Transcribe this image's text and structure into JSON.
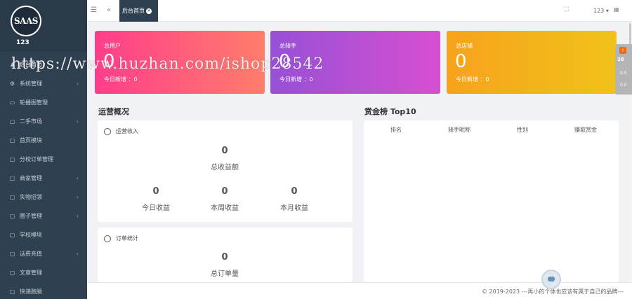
{
  "sidebar": {
    "logo_text": "SAAS",
    "username": "123",
    "items": [
      {
        "label": "后台首页",
        "icon": "user-icon",
        "arrow": false
      },
      {
        "label": "系统管理",
        "icon": "gears-icon",
        "arrow": true
      },
      {
        "label": "轮播图管理",
        "icon": "monitor-icon",
        "arrow": false
      },
      {
        "label": "二手市场",
        "icon": "copy-icon",
        "arrow": true
      },
      {
        "label": "首页模块",
        "icon": "copy-icon",
        "arrow": false
      },
      {
        "label": "分校订单管理",
        "icon": "copy-icon",
        "arrow": false
      },
      {
        "label": "商家管理",
        "icon": "copy-icon",
        "arrow": true
      },
      {
        "label": "失物招领",
        "icon": "copy-icon",
        "arrow": true
      },
      {
        "label": "圈子管理",
        "icon": "copy-icon",
        "arrow": true
      },
      {
        "label": "学校模块",
        "icon": "copy-icon",
        "arrow": false
      },
      {
        "label": "话费充值",
        "icon": "copy-icon",
        "arrow": true
      },
      {
        "label": "文章管理",
        "icon": "copy-icon",
        "arrow": false
      },
      {
        "label": "快递跑腿",
        "icon": "copy-icon",
        "arrow": false
      }
    ]
  },
  "topbar": {
    "tab_label": "后台首页",
    "user": "123 ▾"
  },
  "cards": [
    {
      "label": "总用户",
      "value": "0",
      "sub": "今日新增 ：0",
      "color_from": "#ff3d8b",
      "color_to": "#ff7d6b"
    },
    {
      "label": "总骑手",
      "value": "0",
      "sub": "今日新增 ：0",
      "color_from": "#9650d6",
      "color_to": "#d74fd3"
    },
    {
      "label": "总店铺",
      "value": "0",
      "sub": "今日新增 ：0",
      "color_from": "#f7a21c",
      "color_to": "#f0c21a"
    }
  ],
  "operations": {
    "title": "运营概况",
    "revenue_label": "运营收入",
    "total_value": "0",
    "total_label": "总收益额",
    "stats": [
      {
        "value": "0",
        "label": "今日收益"
      },
      {
        "value": "0",
        "label": "本周收益"
      },
      {
        "value": "0",
        "label": "本月收益"
      }
    ],
    "orders_label": "订单统计",
    "orders_value": "0",
    "orders_total_label": "总订单量"
  },
  "ranking": {
    "title": "赏金榜 Top10",
    "columns": [
      "排名",
      "骑手昵称",
      "性别",
      "赚取赏金"
    ]
  },
  "footer": {
    "text": "© 2019-2023 ---再小的个体也应该有属于自己的品牌---"
  },
  "watermark": "https://www.huzhan.com/ishop28542",
  "side_widget": {
    "badge": "!",
    "temp": "28",
    "m1": "0.0",
    "m2": "0.0"
  }
}
